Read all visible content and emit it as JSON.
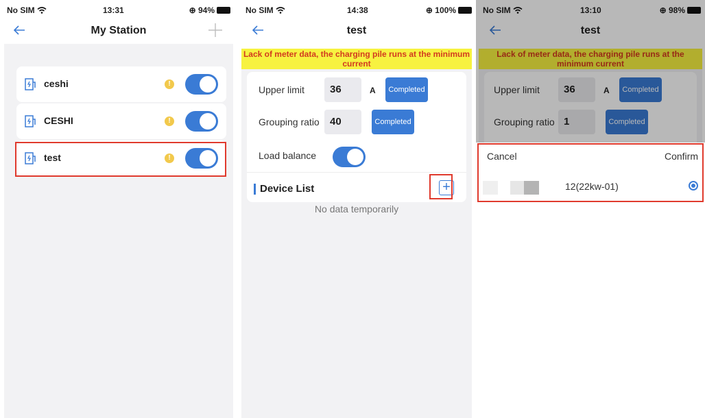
{
  "panel1": {
    "status": {
      "carrier": "No SIM",
      "time": "13:31",
      "battery": "94%"
    },
    "title": "My Station",
    "stations": [
      {
        "name": "ceshi",
        "warning": "!",
        "enabled": true
      },
      {
        "name": "CESHI",
        "warning": "!",
        "enabled": true
      },
      {
        "name": "test",
        "warning": "!",
        "enabled": true
      }
    ]
  },
  "panel2": {
    "status": {
      "carrier": "No SIM",
      "time": "14:38",
      "battery": "100%"
    },
    "title": "test",
    "banner": "Lack of meter data, the charging pile runs at the minimum current",
    "upper_limit": {
      "label": "Upper limit",
      "value": "36",
      "unit": "A",
      "button": "Completed"
    },
    "grouping_ratio": {
      "label": "Grouping ratio",
      "value": "40",
      "button": "Completed"
    },
    "load_balance": {
      "label": "Load balance",
      "enabled": true
    },
    "device_list": {
      "title": "Device List",
      "add": "+",
      "empty": "No data temporarily"
    }
  },
  "panel3": {
    "status": {
      "carrier": "No SIM",
      "time": "13:10",
      "battery": "98%"
    },
    "title": "test",
    "banner": "Lack of meter data, the charging pile runs at the minimum current",
    "upper_limit": {
      "label": "Upper limit",
      "value": "36",
      "unit": "A",
      "button": "Completed"
    },
    "grouping_ratio": {
      "label": "Grouping ratio",
      "value": "1",
      "button": "Completed"
    },
    "picker": {
      "cancel": "Cancel",
      "confirm": "Confirm",
      "device": "12(22kw-01)",
      "selected": true
    }
  },
  "colors": {
    "accent": "#3a7bd5",
    "highlight_border": "#e03a2d",
    "banner_bg": "#f7f240",
    "banner_text": "#d23a1f",
    "warning": "#f2c94c"
  }
}
